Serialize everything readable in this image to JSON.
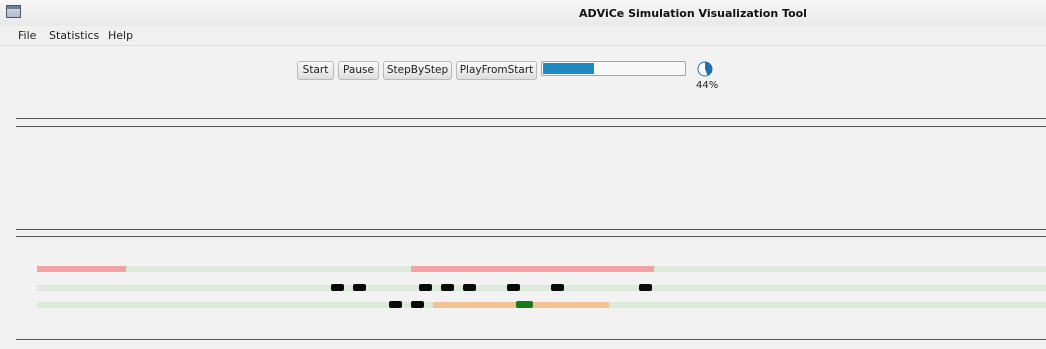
{
  "window": {
    "title": "ADViCe Simulation Visualization Tool",
    "icon": "window-icon"
  },
  "menu": {
    "items": [
      "File",
      "Statistics",
      "Help"
    ]
  },
  "toolbar": {
    "start_label": "Start",
    "pause_label": "Pause",
    "step_label": "StepByStep",
    "play_from_start_label": "PlayFromStart"
  },
  "progress": {
    "fraction": 0.36,
    "color": "#1f8ac2"
  },
  "completion": {
    "label": "44%",
    "value": 0.44,
    "icon": "pie-progress-icon"
  },
  "timeline": {
    "colors": {
      "track": "#dcebd9",
      "busy": "#f2a3a3",
      "pending": "#f0c294",
      "job": "#0a0a0a",
      "active_job": "#197a17"
    }
  }
}
